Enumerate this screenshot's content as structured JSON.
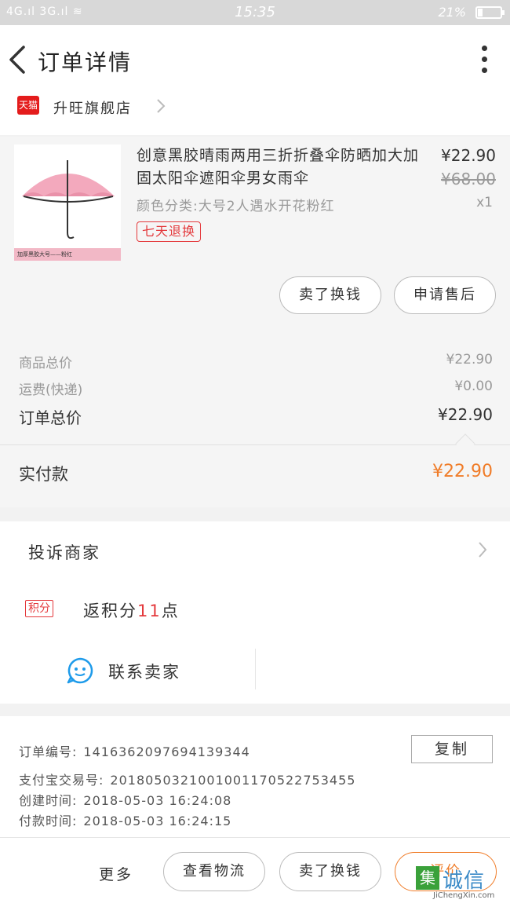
{
  "status_bar": {
    "signal": "4G.ıl 3G.ıl ≋",
    "time": "15:35",
    "battery": "21%",
    "battery_level": 0.21
  },
  "header": {
    "title": "订单详情"
  },
  "shop": {
    "badge": "天猫",
    "name": "升旺旗舰店"
  },
  "product": {
    "image_caption": "加厚黑胶大号——粉红",
    "name": "创意黑胶晴雨两用三折折叠伞防晒加大加固太阳伞遮阳伞男女雨伞",
    "price": "¥22.90",
    "original_price": "¥68.00",
    "spec": "颜色分类:大号2人遇水开花粉红",
    "quantity": "x1",
    "tag": "七天退换",
    "buttons": [
      "卖了换钱",
      "申请售后"
    ]
  },
  "totals": {
    "goods_label": "商品总价",
    "goods_value": "¥22.90",
    "shipping_label": "运费(快递)",
    "shipping_value": "¥0.00",
    "order_label": "订单总价",
    "order_value": "¥22.90",
    "paid_label": "实付款",
    "paid_value": "¥22.90"
  },
  "actions": {
    "complain": "投诉商家",
    "points_badge": "积分",
    "points_prefix": "返积分",
    "points_value": "11",
    "points_suffix": "点",
    "contact": "联系卖家"
  },
  "info": {
    "order_no_label": "订单编号:",
    "order_no": "1416362097694139344",
    "copy": "复制",
    "alipay_label": "支付宝交易号:",
    "alipay_no": "2018050321001001170522753455",
    "created_label": "创建时间:",
    "created": "2018-05-03 16:24:08",
    "paid_label": "付款时间:",
    "paid": "2018-05-03 16:24:15"
  },
  "bottom": {
    "more": "更多",
    "logistics": "查看物流",
    "sell": "卖了换钱",
    "review": "评价"
  },
  "watermark": {
    "mark": "集",
    "text": "诚信",
    "url": "JiChengXin.com"
  },
  "colors": {
    "accent_orange": "#f07c28",
    "tmall_red": "#e41c1c",
    "points_red": "#e4393c"
  }
}
